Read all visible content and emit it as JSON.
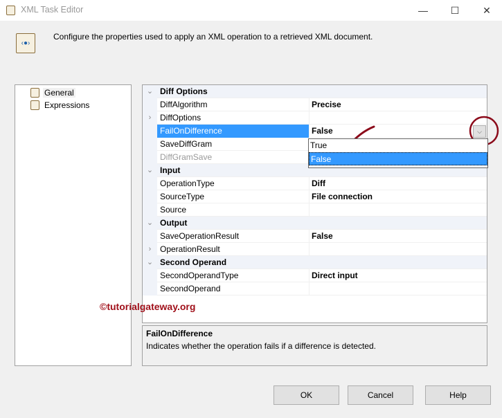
{
  "window": {
    "title": "XML Task Editor",
    "minimize": "—",
    "maximize": "☐",
    "close": "✕"
  },
  "intro": "Configure the properties used to apply an XML operation to a retrieved XML document.",
  "nav": {
    "items": [
      {
        "label": "General"
      },
      {
        "label": "Expressions"
      }
    ]
  },
  "grid": {
    "rows": [
      {
        "type": "cat",
        "name": "Diff Options",
        "glyph": "⌄"
      },
      {
        "name": "DiffAlgorithm",
        "value": "Precise"
      },
      {
        "name": "DiffOptions",
        "value": "",
        "glyph": "›"
      },
      {
        "name": "FailOnDifference",
        "value": "False",
        "selected": true
      },
      {
        "name": "SaveDiffGram",
        "value": ""
      },
      {
        "name": "DiffGramSave",
        "value": "",
        "disabled": true
      },
      {
        "type": "cat",
        "name": "Input",
        "glyph": "⌄"
      },
      {
        "name": "OperationType",
        "value": "Diff"
      },
      {
        "name": "SourceType",
        "value": "File connection"
      },
      {
        "name": "Source",
        "value": ""
      },
      {
        "type": "cat",
        "name": "Output",
        "glyph": "⌄"
      },
      {
        "name": "SaveOperationResult",
        "value": "False"
      },
      {
        "name": "OperationResult",
        "value": "",
        "glyph": "›"
      },
      {
        "type": "cat",
        "name": "Second Operand",
        "glyph": "⌄"
      },
      {
        "name": "SecondOperandType",
        "value": "Direct input"
      },
      {
        "name": "SecondOperand",
        "value": ""
      }
    ]
  },
  "dropdown": {
    "options": [
      "True",
      "False"
    ],
    "selected": "False",
    "button_glyph": "⌵"
  },
  "watermark": "©tutorialgateway.org",
  "description": {
    "title": "FailOnDifference",
    "text": "Indicates whether the operation fails if a difference is detected."
  },
  "buttons": {
    "ok": "OK",
    "cancel": "Cancel",
    "help": "Help"
  },
  "annotation_color": "#8b0a1a"
}
